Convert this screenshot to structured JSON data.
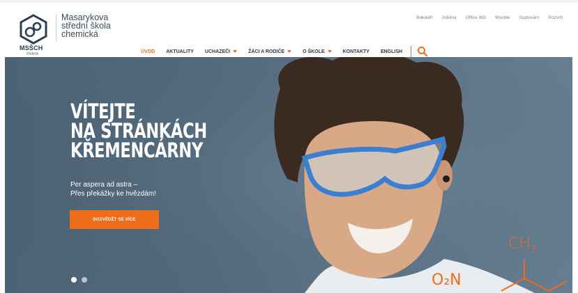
{
  "logo": {
    "abbr": "MSŠCH",
    "sub": "PRAHA",
    "lines": [
      "Masarykova",
      "střední škola",
      "chemická"
    ]
  },
  "toplinks": [
    "Bakaláři",
    "Jídelna",
    "Office 365",
    "Moodle",
    "Suplování",
    "Rozvrh"
  ],
  "nav": [
    {
      "label": "ÚVOD",
      "active": true,
      "dropdown": false
    },
    {
      "label": "AKTUALITY",
      "active": false,
      "dropdown": false
    },
    {
      "label": "UCHAZEČI",
      "active": false,
      "dropdown": true
    },
    {
      "label": "ŽÁCI A RODIČE",
      "active": false,
      "dropdown": true
    },
    {
      "label": "O ŠKOLE",
      "active": false,
      "dropdown": true
    },
    {
      "label": "KONTAKTY",
      "active": false,
      "dropdown": false
    },
    {
      "label": "ENGLISH",
      "active": false,
      "dropdown": false
    }
  ],
  "hero": {
    "title": [
      "VÍTEJTE",
      "NA STRÁNKÁCH",
      "KŘEMENCÁRNY"
    ],
    "motto": [
      "Per aspera ad astra –",
      "Přes překážky ke hvězdám!"
    ],
    "cta": "DOZVĚDĚT SE VÍCE",
    "slides_total": 2,
    "slide_active": 1
  },
  "formula": {
    "methyl": "CH",
    "methyl_sub": "3",
    "nitro": "O₂N"
  },
  "icons": {
    "search": "search-icon",
    "logo": "molecule-logo-icon"
  },
  "colors": {
    "accent": "#ef6c1a",
    "nav_text": "#2b3947",
    "hero_bg": "#566d80"
  }
}
